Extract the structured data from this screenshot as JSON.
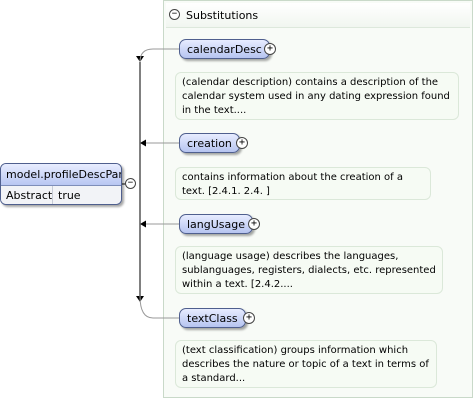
{
  "model": {
    "name": "model.profileDescPart",
    "property_label": "Abstract",
    "property_value": "true"
  },
  "substitutions": {
    "title": "Substitutions",
    "items": [
      {
        "label": "calendarDesc",
        "description": "(calendar description) contains a description of the calendar system used in any dating expression found in the text...."
      },
      {
        "label": "creation",
        "description": "contains information about the creation of a text. [2.4.1. 2.4. ]"
      },
      {
        "label": "langUsage",
        "description": "(language usage) describes the languages, sublanguages, registers, dialects, etc. represented within a text. [2.4.2...."
      },
      {
        "label": "textClass",
        "description": "(text classification) groups information which describes the nature or topic of a text in terms of a standard..."
      }
    ]
  },
  "icons": {
    "collapse": "minus-circle-icon",
    "expand": "plus-circle-icon",
    "connector_arrow": "arrow-right-icon"
  },
  "colors": {
    "element_fill_top": "#e7ecff",
    "element_fill_bottom": "#b6c4f0",
    "element_border": "#4f5f8e",
    "panel_background": "#f8fbf7",
    "panel_border": "#c9d9c9",
    "connector": "#000000"
  }
}
